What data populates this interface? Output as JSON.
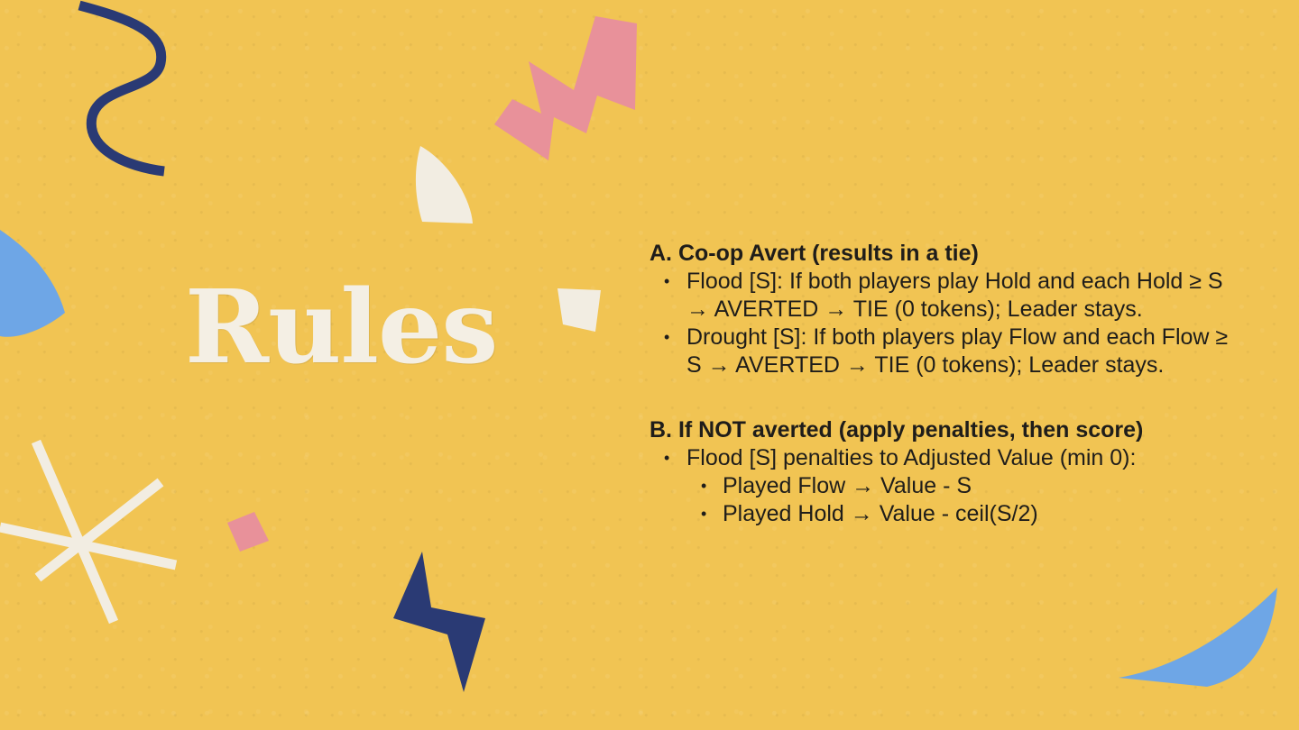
{
  "slide": {
    "title": "Rules",
    "colors": {
      "background": "#f1c453",
      "title": "#f4efe4",
      "text": "#1f1d1a",
      "navy": "#2a3a74",
      "pink": "#e8919a",
      "blue": "#6ea6e6",
      "paper_white": "#f2ede2"
    },
    "decorations": [
      "navy-squiggle-icon",
      "pink-zigzag-icon",
      "paper-half-circle-icon",
      "blue-leaf-icon",
      "paper-quad-icon",
      "paper-star-icon",
      "pink-square-icon",
      "navy-lightning-icon",
      "blue-bowl-icon"
    ]
  },
  "rules": {
    "section_a": {
      "heading": "A. Co-op Avert (results in a tie)",
      "items": [
        "Flood [S]: If both players play Hold and each Hold ≥ S → AVERTED → TIE (0 tokens); Leader stays.",
        "Drought [S]: If both players play Flow and each Flow ≥ S → AVERTED → TIE (0 tokens); Leader stays."
      ]
    },
    "section_b": {
      "heading": "B. If NOT averted (apply penalties, then score)",
      "item": "Flood [S] penalties to Adjusted Value (min 0):",
      "subitems": [
        "Played Flow → Value - S",
        "Played Hold → Value - ceil(S/2)"
      ]
    }
  }
}
